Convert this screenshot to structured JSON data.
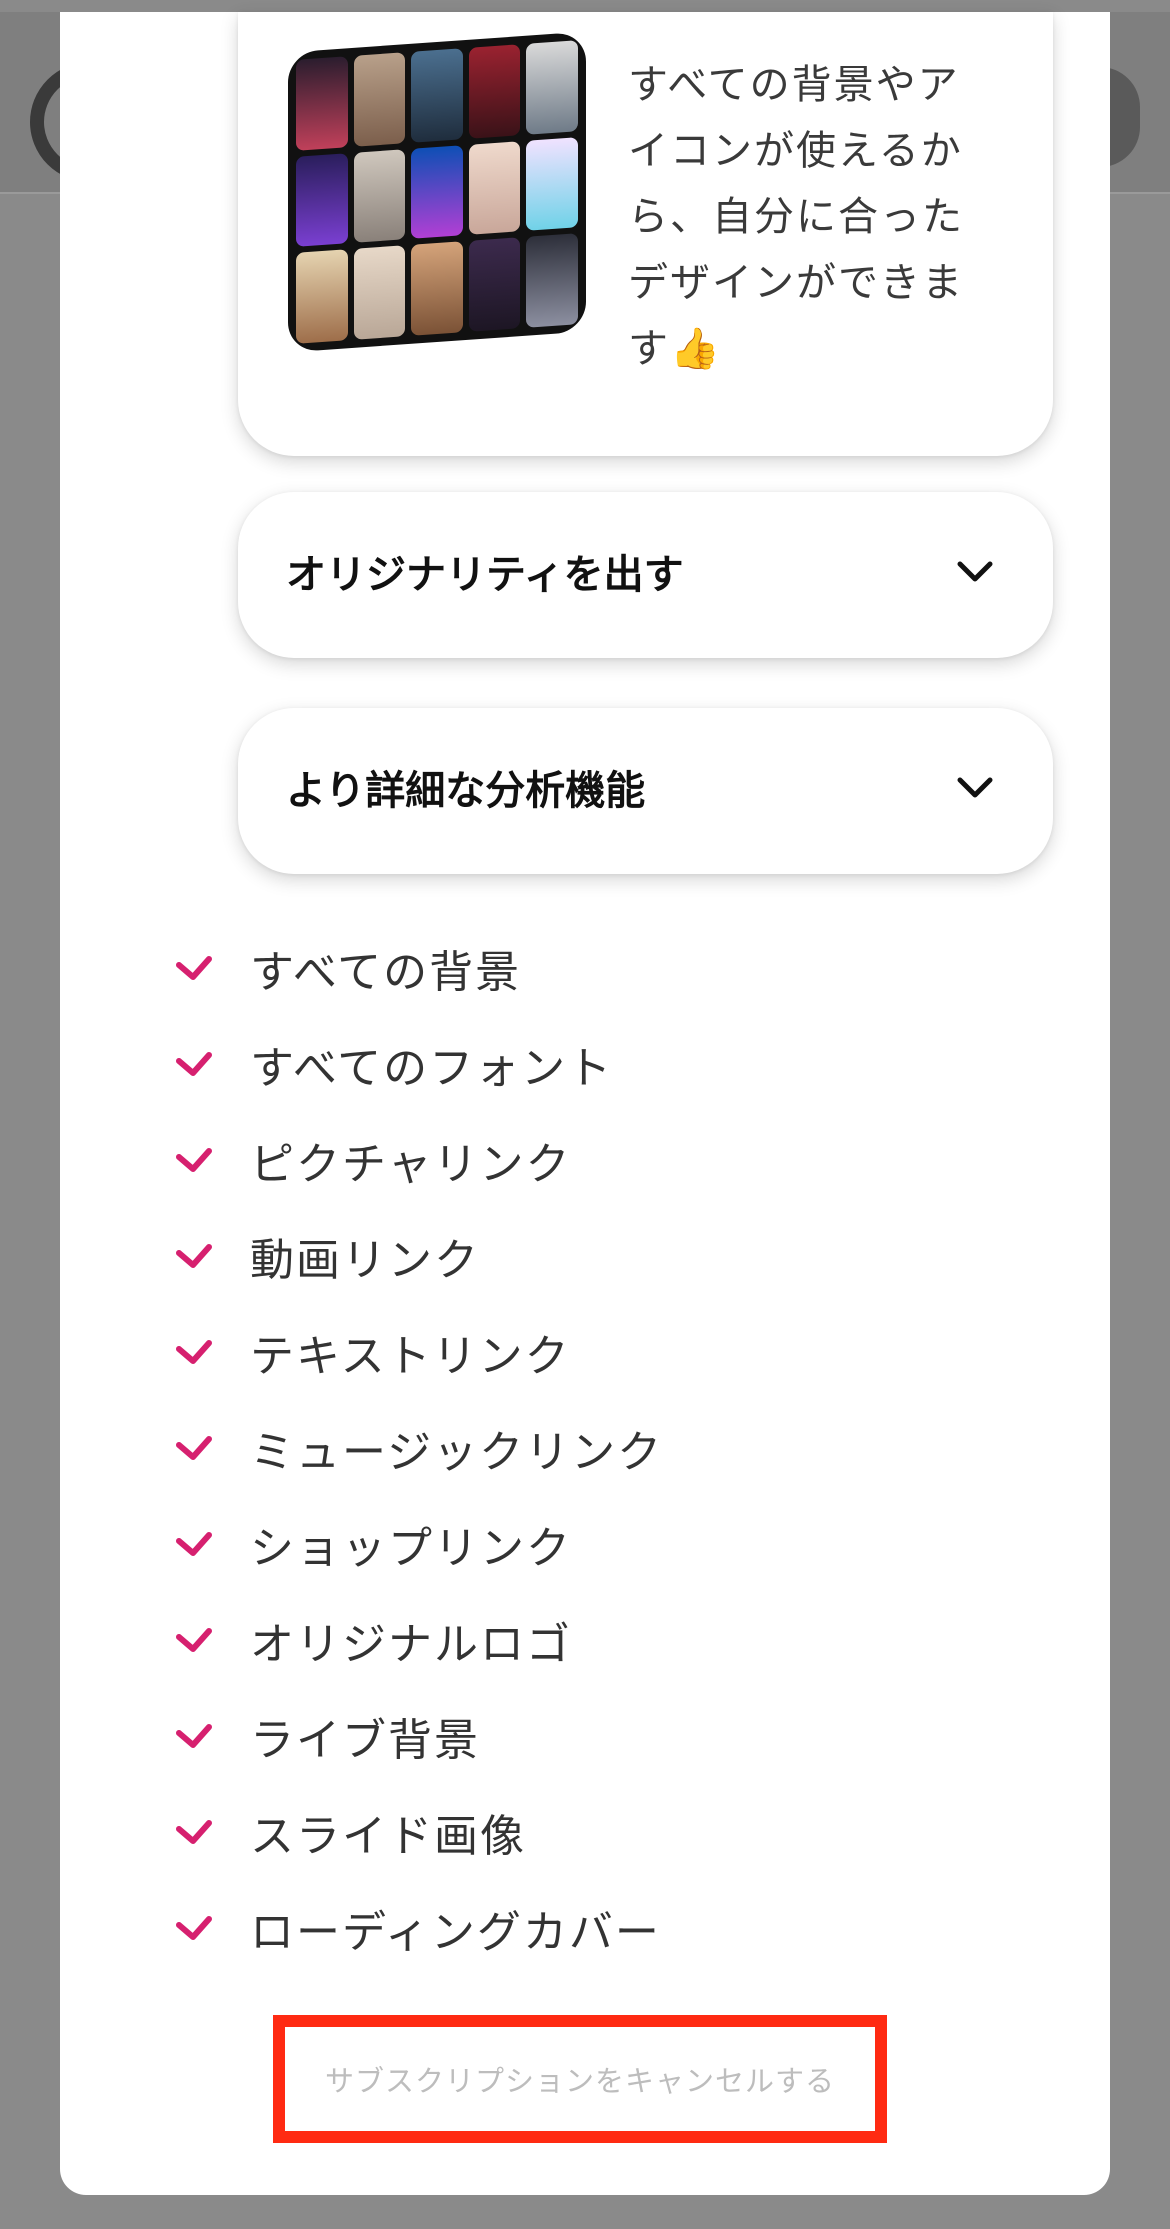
{
  "colors": {
    "accent": "#d6206f",
    "highlight_border": "#ff2a12",
    "overlay": "#8a8a8a"
  },
  "info_card": {
    "text": "すべての背景やアイコンが使えるから、自分に合ったデザインができます👍"
  },
  "accordions": [
    {
      "title": "オリジナリティを出す",
      "icon": "chevron-down-icon"
    },
    {
      "title": "より詳細な分析機能",
      "icon": "chevron-down-icon"
    }
  ],
  "features": [
    "すべての背景",
    "すべてのフォント",
    "ピクチャリンク",
    "動画リンク",
    "テキストリンク",
    "ミュージックリンク",
    "ショップリンク",
    "オリジナルロゴ",
    "ライブ背景",
    "スライド画像",
    "ローディングカバー"
  ],
  "cancel_link": "サブスクリプションをキャンセルする"
}
